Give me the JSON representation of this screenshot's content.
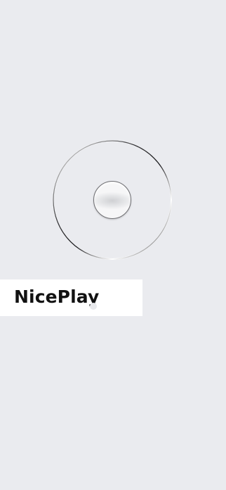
{
  "app": {
    "name": "NicePlay"
  },
  "colors": {
    "background": "#eaebef",
    "panel": "#ffffff",
    "text": "#111111",
    "ring": "#2a2a2e"
  },
  "icons": {
    "dial": "dial-ring-icon",
    "knob": "knob-icon",
    "dot": "dot-icon"
  }
}
